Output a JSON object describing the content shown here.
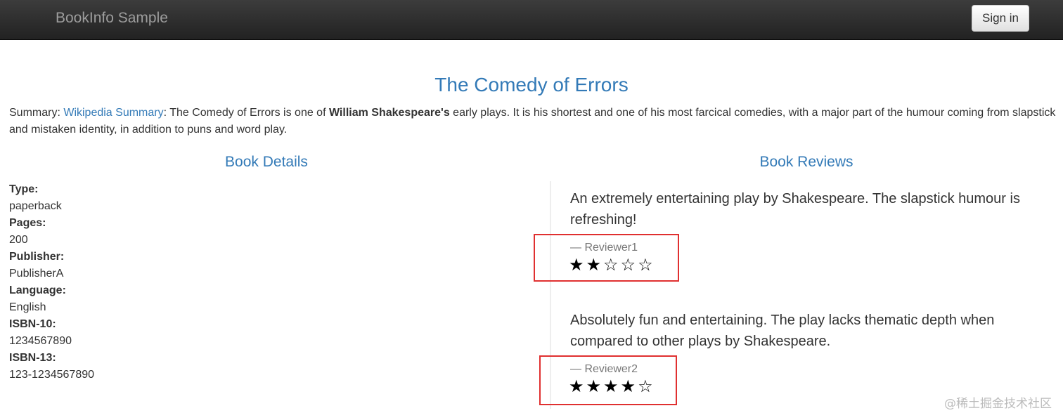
{
  "navbar": {
    "brand": "BookInfo Sample",
    "signin_label": "Sign in"
  },
  "book": {
    "title": "The Comedy of Errors",
    "summary_label": "Summary: ",
    "summary_link": "Wikipedia Summary",
    "summary_part1": ": The Comedy of Errors is one of ",
    "summary_bold": "William Shakespeare's",
    "summary_part2": " early plays. It is his shortest and one of his most farcical comedies, with a major part of the humour coming from slapstick and mistaken identity, in addition to puns and word play."
  },
  "details": {
    "heading": "Book Details",
    "items": [
      {
        "label": "Type:",
        "value": "paperback"
      },
      {
        "label": "Pages:",
        "value": "200"
      },
      {
        "label": "Publisher:",
        "value": "PublisherA"
      },
      {
        "label": "Language:",
        "value": "English"
      },
      {
        "label": "ISBN-10:",
        "value": "1234567890"
      },
      {
        "label": "ISBN-13:",
        "value": "123-1234567890"
      }
    ]
  },
  "reviews": {
    "heading": "Book Reviews",
    "items": [
      {
        "text": "An extremely entertaining play by Shakespeare. The slapstick humour is refreshing!",
        "reviewer": "— Reviewer1",
        "stars": "★★☆☆☆",
        "rating": 2,
        "max_rating": 5
      },
      {
        "text": "Absolutely fun and entertaining. The play lacks thematic depth when compared to other plays by Shakespeare.",
        "reviewer": "— Reviewer2",
        "stars": "★★★★☆",
        "rating": 4,
        "max_rating": 5
      }
    ]
  },
  "watermark": "@稀土掘金技术社区",
  "colors": {
    "link": "#337ab7",
    "navbar": "#222222",
    "highlight": "#e03030"
  }
}
